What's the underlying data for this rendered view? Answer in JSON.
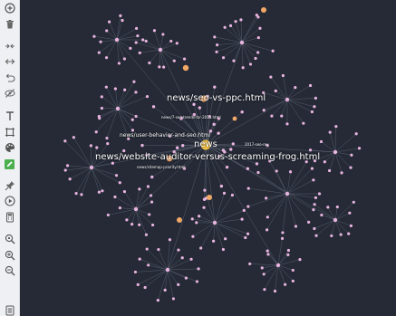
{
  "toolbar": {
    "tools": [
      {
        "name": "add-node-button",
        "icon": "plus-circle-icon"
      },
      {
        "name": "delete-button",
        "icon": "trash-icon"
      },
      {
        "name": "collapse-button",
        "icon": "collapse-arrows-icon"
      },
      {
        "name": "expand-button",
        "icon": "expand-arrows-icon"
      },
      {
        "name": "undo-button",
        "icon": "undo-arrow-icon"
      },
      {
        "name": "hide-button",
        "icon": "eye-off-icon"
      },
      {
        "name": "text-tool-button",
        "icon": "text-icon"
      },
      {
        "name": "frame-tool-button",
        "icon": "frame-icon"
      },
      {
        "name": "palette-button",
        "icon": "palette-icon"
      },
      {
        "name": "edit-button",
        "icon": "pencil-square-icon"
      },
      {
        "name": "pin-button",
        "icon": "pin-icon"
      },
      {
        "name": "play-button",
        "icon": "play-icon"
      },
      {
        "name": "calculator-button",
        "icon": "calculator-icon"
      },
      {
        "name": "zoom-fit-button",
        "icon": "zoom-fit-icon"
      },
      {
        "name": "zoom-in-button",
        "icon": "zoom-in-icon"
      },
      {
        "name": "zoom-out-button",
        "icon": "zoom-out-icon"
      },
      {
        "name": "list-button",
        "icon": "list-icon"
      }
    ],
    "active_tool": "edit-button",
    "active_color": "#4caf50"
  },
  "graph": {
    "background": "#252a36",
    "labels": [
      {
        "text": "news/seo-vs-ppc.html",
        "size": "lg"
      },
      {
        "text": "news/7-seo-trends-for-2016.html",
        "size": "sm"
      },
      {
        "text": "news/user-behavior-and-seo.html",
        "size": "md"
      },
      {
        "text": "news",
        "size": "lg"
      },
      {
        "text": "2017-seo-rev",
        "size": "sm"
      },
      {
        "text": "news/website-auditor-versus-screaming-frog.html",
        "size": "lg"
      },
      {
        "text": "news/sitemap-priority.html",
        "size": "sm"
      }
    ],
    "colors": {
      "node": "#e8b4e0",
      "hub": "#f2a866",
      "focus": "#f5c242",
      "edge": "#7d8496"
    }
  }
}
